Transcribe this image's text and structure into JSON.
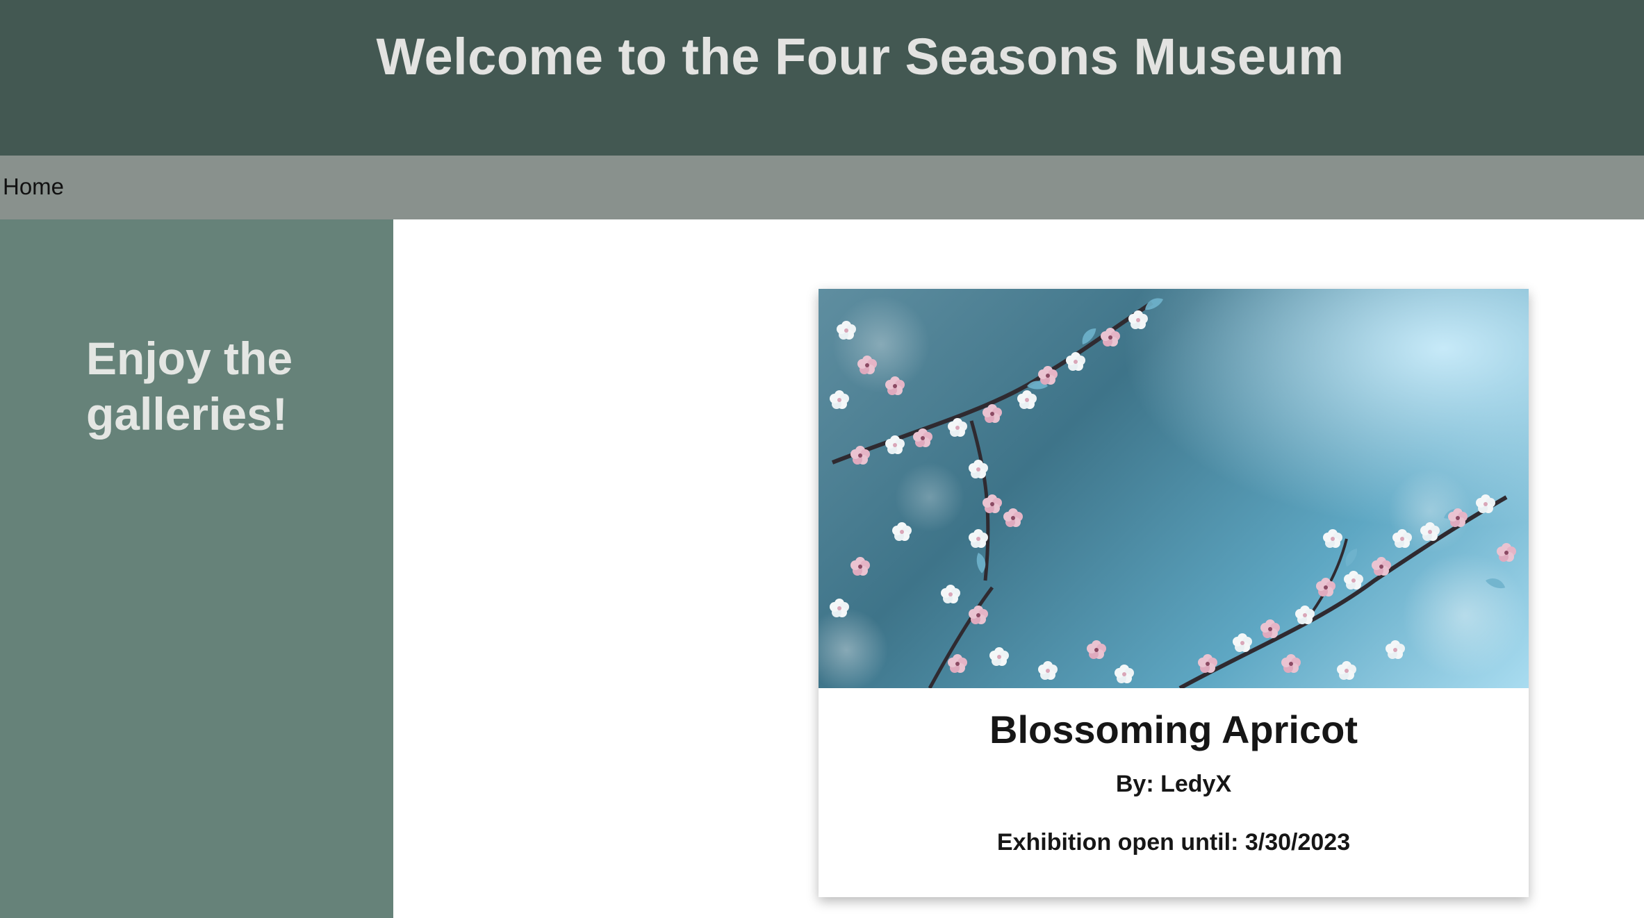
{
  "header": {
    "title": "Welcome to the Four Seasons Museum"
  },
  "nav": {
    "items": [
      {
        "label": "Home"
      }
    ]
  },
  "sidebar": {
    "text": "Enjoy the galleries!"
  },
  "gallery": {
    "card": {
      "image_subject": "blossoming apricot branches",
      "title": "Blossoming Apricot",
      "author": "By: LedyX",
      "exhibition": "Exhibition open until: 3/30/2023"
    }
  },
  "colors": {
    "header_bg": "#435852",
    "nav_bg": "#89918d",
    "sidebar_bg": "#668279",
    "title_text": "#e3e3e1"
  }
}
